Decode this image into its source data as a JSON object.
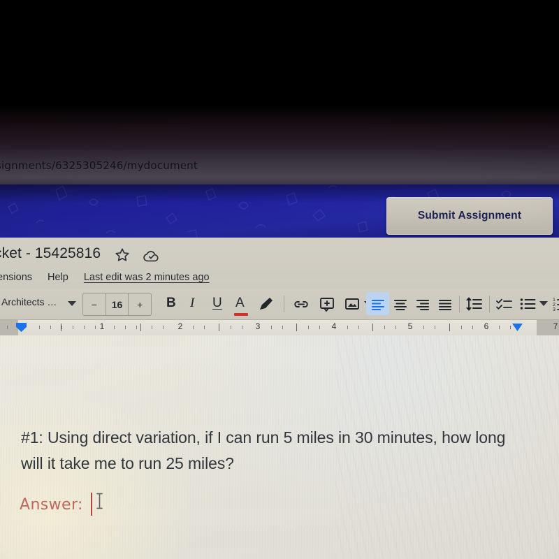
{
  "browser": {
    "url_fragment": "signments/6325305246/mydocument"
  },
  "canvas_banner": {
    "submit_label": "Submit Assignment",
    "banner_color": "#20219c",
    "button_color": "#c4c0b5"
  },
  "docs": {
    "title": "cket - 15425816",
    "star_icon": "star-icon",
    "cloud_icon": "cloud-saved-icon",
    "menu_items": [
      "tensions",
      "Help"
    ],
    "last_edit": "Last edit was 2 minutes ago",
    "mode_button_icon": "editing-mode-icon"
  },
  "toolbar": {
    "font_name": "Architects …",
    "font_size": "16",
    "decrease_label": "−",
    "increase_label": "+",
    "bold_label": "B",
    "italic_label": "I",
    "underline_label": "U",
    "text_color_label": "A",
    "text_color_swatch": "#d6302a",
    "highlight_icon": "highlighter-pen-icon",
    "link_icon": "insert-link-icon",
    "comment_icon": "add-comment-icon",
    "image_icon": "insert-image-icon",
    "image_dropdown_icon": "chevron-down-icon",
    "align_left_icon": "align-left-icon",
    "align_center_icon": "align-center-icon",
    "align_right_icon": "align-right-icon",
    "align_justify_icon": "align-justify-icon",
    "line_spacing_icon": "line-spacing-icon",
    "checklist_icon": "checklist-icon",
    "bullet_list_icon": "bulleted-list-icon",
    "bullet_dropdown_icon": "chevron-down-icon",
    "numbered_list_icon": "numbered-list-icon",
    "active_alignment": "left",
    "active_highlight_color": "#bcd4ef"
  },
  "ruler": {
    "numbers": [
      "1",
      "2",
      "3",
      "4",
      "5",
      "6",
      "7"
    ],
    "left_indent_icon": "indent-marker-icon",
    "right_indent_icon": "indent-marker-icon",
    "marker_color": "#1a73e8"
  },
  "document": {
    "question": "#1: Using direct variation, if I can run 5 miles in 30 minutes, how long will it take me to run 25 miles?",
    "answer_label": "Answer:",
    "answer_value": "",
    "answer_color": "#c0685f",
    "caret_color": "#b3463c",
    "cursor_icon": "text-ibeam-cursor",
    "page_color": "#e9e7dd"
  }
}
